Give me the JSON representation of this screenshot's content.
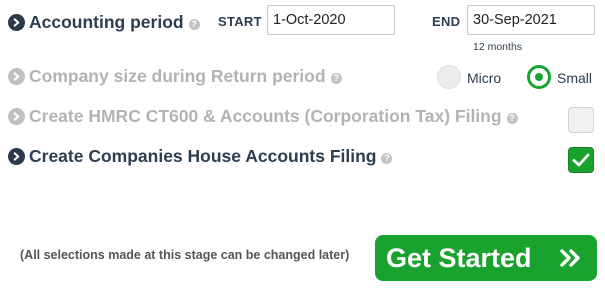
{
  "accounting_period": {
    "label": "Accounting period",
    "start_label": "START",
    "start_value": "1-Oct-2020",
    "end_label": "END",
    "end_value": "30-Sep-2021",
    "duration": "12 months"
  },
  "company_size": {
    "label": "Company size during Return period",
    "options": [
      {
        "label": "Micro",
        "selected": false
      },
      {
        "label": "Small",
        "selected": true
      }
    ]
  },
  "hmrc_filing": {
    "label": "Create HMRC CT600 & Accounts (Corporation Tax) Filing",
    "checked": false
  },
  "companies_house_filing": {
    "label": "Create Companies House Accounts Filing",
    "checked": true
  },
  "footer": {
    "note": "(All selections made at this stage can be changed later)",
    "button_label": "Get Started"
  },
  "colors": {
    "accent_green": "#1aa22f",
    "text_dark": "#2d3e50",
    "text_disabled": "#b3b3b3"
  }
}
